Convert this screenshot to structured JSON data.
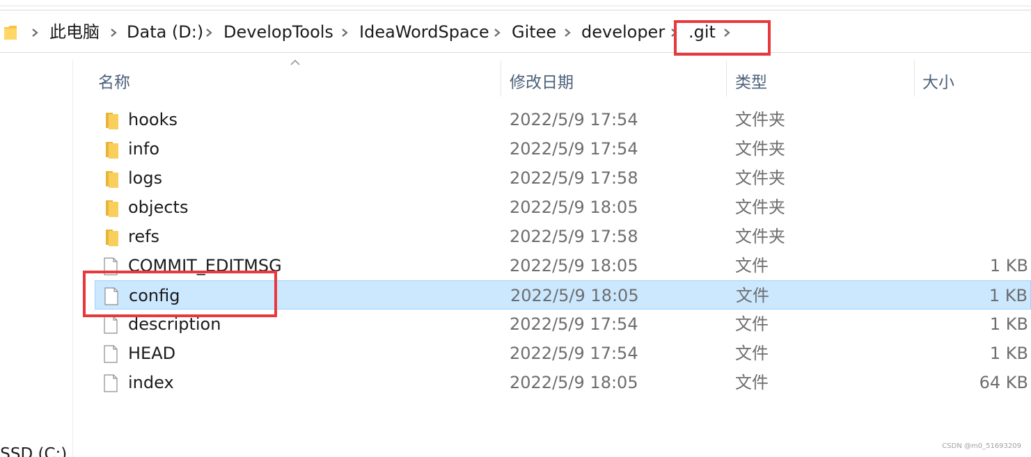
{
  "breadcrumb": {
    "items": [
      "此电脑",
      "Data (D:)",
      "DevelopTools",
      "IdeaWordSpace",
      "Gitee",
      "developer",
      ".git"
    ]
  },
  "columns": {
    "name": "名称",
    "modified": "修改日期",
    "type": "类型",
    "size": "大小"
  },
  "files": [
    {
      "name": "hooks",
      "modified": "2022/5/9 17:54",
      "type": "文件夹",
      "size": "",
      "icon": "folder-icon"
    },
    {
      "name": "info",
      "modified": "2022/5/9 17:54",
      "type": "文件夹",
      "size": "",
      "icon": "folder-icon"
    },
    {
      "name": "logs",
      "modified": "2022/5/9 17:58",
      "type": "文件夹",
      "size": "",
      "icon": "folder-icon"
    },
    {
      "name": "objects",
      "modified": "2022/5/9 18:05",
      "type": "文件夹",
      "size": "",
      "icon": "folder-icon"
    },
    {
      "name": "refs",
      "modified": "2022/5/9 17:58",
      "type": "文件夹",
      "size": "",
      "icon": "folder-icon"
    },
    {
      "name": "COMMIT_EDITMSG",
      "modified": "2022/5/9 18:05",
      "type": "文件",
      "size": "1 KB",
      "icon": "file-icon"
    },
    {
      "name": "config",
      "modified": "2022/5/9 18:05",
      "type": "文件",
      "size": "1 KB",
      "icon": "file-icon",
      "selected": true
    },
    {
      "name": "description",
      "modified": "2022/5/9 17:54",
      "type": "文件",
      "size": "1 KB",
      "icon": "file-icon"
    },
    {
      "name": "HEAD",
      "modified": "2022/5/9 17:54",
      "type": "文件",
      "size": "1 KB",
      "icon": "file-icon"
    },
    {
      "name": "index",
      "modified": "2022/5/9 18:05",
      "type": "文件",
      "size": "64 KB",
      "icon": "file-icon"
    }
  ],
  "sidebar": {
    "drive_label": "-SSD (C:)"
  },
  "watermark": "CSDN @m0_51693209",
  "colors": {
    "selection": "#cce8ff",
    "selection_border": "#99d1ff",
    "highlight": "#e8383b",
    "folder": "#f5c542",
    "header_text": "#4c607a"
  }
}
